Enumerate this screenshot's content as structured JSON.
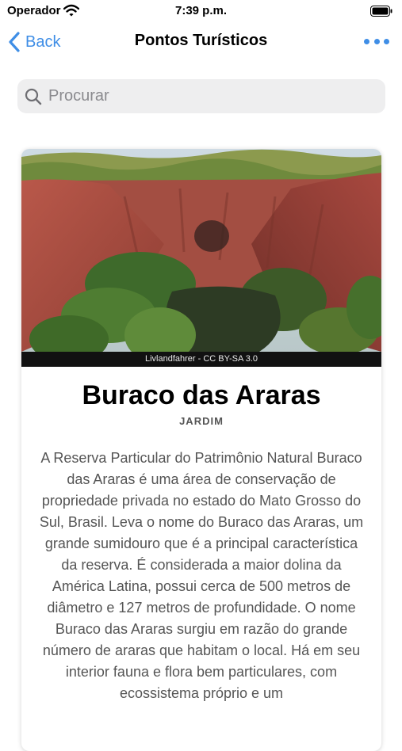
{
  "status_bar": {
    "carrier": "Operador",
    "time": "7:39 p.m."
  },
  "nav": {
    "back_label": "Back",
    "title": "Pontos Turísticos"
  },
  "search": {
    "placeholder": "Procurar",
    "value": ""
  },
  "place": {
    "photo_credit": "Livlandfahrer - CC BY-SA 3.0",
    "name": "Buraco das Araras",
    "region": "JARDIM",
    "description": "A Reserva Particular do Patrimônio Natural Buraco das Araras é uma área de conservação de propriedade privada no estado do Mato Grosso do Sul, Brasil. Leva o nome do Buraco das Araras, um grande sumidouro que é a principal característica da reserva. É considerada a maior dolina da América Latina, possui cerca de 500 metros de diâmetro e 127 metros de profundidade. O nome Buraco das Araras surgiu em razão do grande número de araras que habitam o local. Há em seu interior fauna e flora bem particulares, com ecossistema próprio e um"
  },
  "colors": {
    "accent": "#3f8ee6",
    "search_bg": "#eeeeef",
    "text_secondary": "#555555"
  },
  "icons": [
    "wifi-icon",
    "battery-icon",
    "chevron-left-icon",
    "more-icon",
    "search-icon"
  ]
}
